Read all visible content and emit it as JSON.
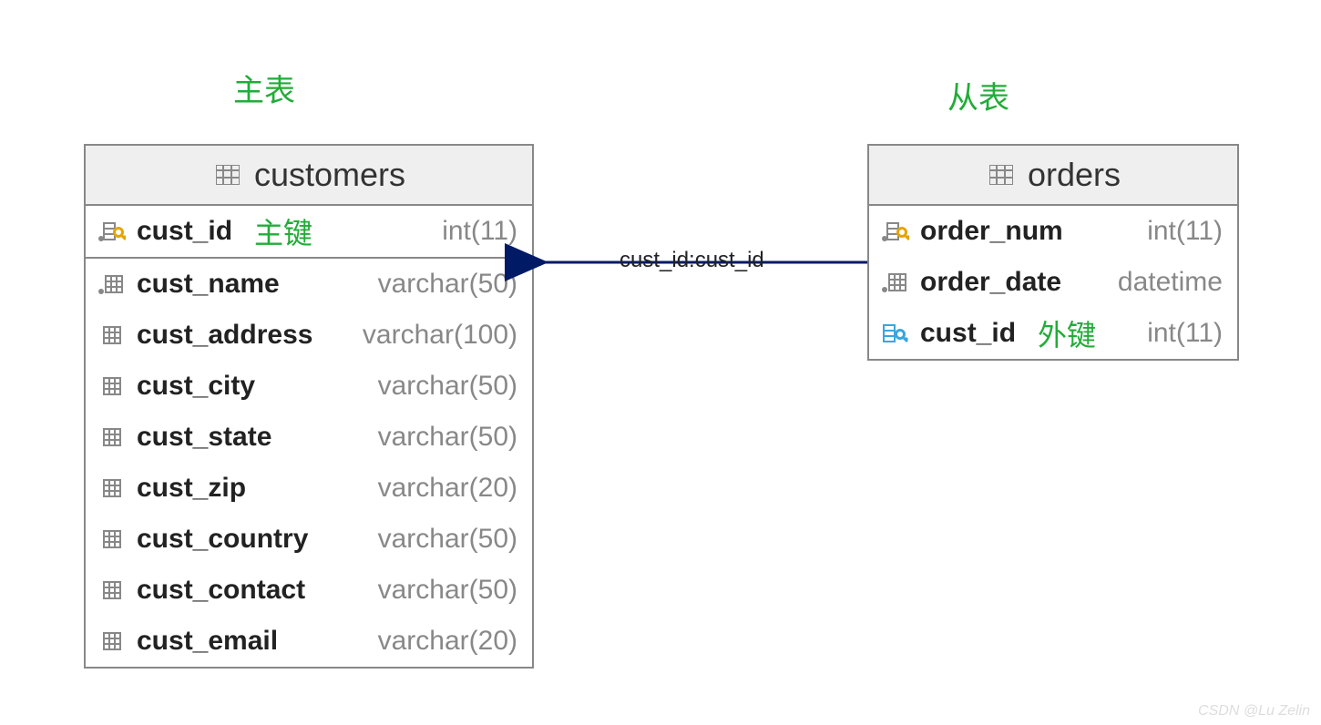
{
  "labels": {
    "main_table": "主表",
    "child_table": "从表",
    "primary_key": "主键",
    "foreign_key": "外键",
    "relation": "cust_id:cust_id",
    "watermark": "CSDN @Lu Zelin"
  },
  "tables": {
    "customers": {
      "title": "customers",
      "columns": [
        {
          "name": "cust_id",
          "type": "int(11)",
          "annot": "primary_key",
          "icon": "pk",
          "sep": true
        },
        {
          "name": "cust_name",
          "type": "varchar(50)",
          "icon": "col-dot"
        },
        {
          "name": "cust_address",
          "type": "varchar(100)",
          "icon": "col"
        },
        {
          "name": "cust_city",
          "type": "varchar(50)",
          "icon": "col"
        },
        {
          "name": "cust_state",
          "type": "varchar(50)",
          "icon": "col"
        },
        {
          "name": "cust_zip",
          "type": "varchar(20)",
          "icon": "col"
        },
        {
          "name": "cust_country",
          "type": "varchar(50)",
          "icon": "col"
        },
        {
          "name": "cust_contact",
          "type": "varchar(50)",
          "icon": "col"
        },
        {
          "name": "cust_email",
          "type": "varchar(20)",
          "icon": "col"
        }
      ]
    },
    "orders": {
      "title": "orders",
      "columns": [
        {
          "name": "order_num",
          "type": "int(11)",
          "icon": "pk"
        },
        {
          "name": "order_date",
          "type": "datetime",
          "icon": "col-dot"
        },
        {
          "name": "cust_id",
          "type": "int(11)",
          "annot": "foreign_key",
          "icon": "fk"
        }
      ]
    }
  },
  "relation": {
    "from_table": "orders",
    "from_column": "cust_id",
    "to_table": "customers",
    "to_column": "cust_id"
  }
}
